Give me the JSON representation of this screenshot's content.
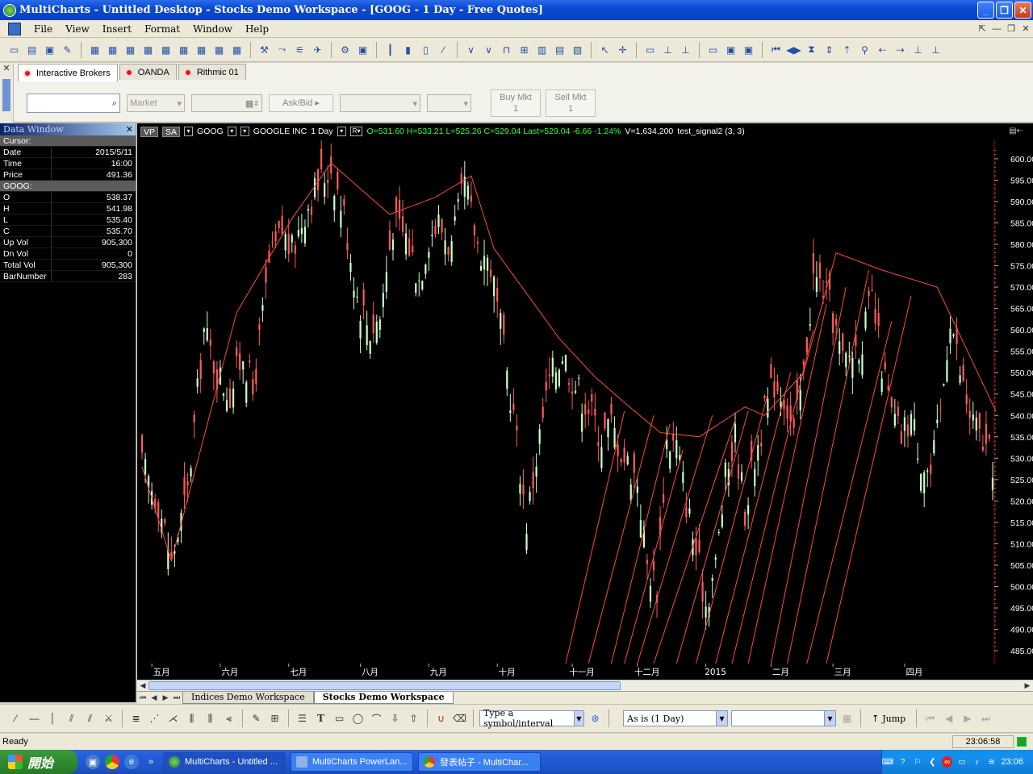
{
  "window": {
    "title": "MultiCharts - Untitled Desktop - Stocks Demo Workspace - [GOOG - 1 Day - Free Quotes]"
  },
  "menu": [
    "File",
    "View",
    "Insert",
    "Format",
    "Window",
    "Help"
  ],
  "trading_panel": {
    "tabs": [
      "Interactive Brokers",
      "OANDA",
      "Rithmic 01"
    ],
    "order_type": "Market",
    "price_mode": "Ask/Bid",
    "buy_label": "Buy Mkt",
    "buy_qty": "1",
    "sell_label": "Sell Mkt",
    "sell_qty": "1"
  },
  "data_window": {
    "title": "Data Window",
    "cursor_header": "Cursor:",
    "date_label": "Date",
    "date_value": "2015/5/11",
    "time_label": "Time",
    "time_value": "16:00",
    "price_label": "Price",
    "price_value": "491.36",
    "symbol_header": "GOOG:",
    "o_label": "O",
    "o_value": "538.37",
    "h_label": "H",
    "h_value": "541.98",
    "l_label": "L",
    "l_value": "535.40",
    "c_label": "C",
    "c_value": "535.70",
    "upvol_label": "Up Vol",
    "upvol_value": "905,300",
    "dnvol_label": "Dn Vol",
    "dnvol_value": "0",
    "totvol_label": "Total Vol",
    "totvol_value": "905,300",
    "barnum_label": "BarNumber",
    "barnum_value": "283"
  },
  "chart_header": {
    "vp": "VP",
    "sa": "SA",
    "symbol": "GOOG",
    "description": "GOOGLE INC",
    "interval": "1 Day",
    "r": "R",
    "ohlc": "O=531.60  H=533.21  L=525.26  C=529.04  Last=529.04  -6.66  -1.24%",
    "volume": "V=1,634,200",
    "study": "test_signal2 (3, 3)"
  },
  "chart_data": {
    "type": "candlestick",
    "ylim": [
      482,
      603
    ],
    "y_ticks": [
      485,
      490,
      495,
      500,
      505,
      510,
      515,
      520,
      525,
      530,
      535,
      540,
      545,
      550,
      555,
      560,
      565,
      570,
      575,
      580,
      585,
      590,
      595,
      600
    ],
    "y_tick_labels": [
      "485.00",
      "490.00",
      "495.00",
      "500.00",
      "505.00",
      "510.00",
      "515.00",
      "520.00",
      "525.00",
      "530.00",
      "535.00",
      "540.00",
      "545.00",
      "550.00",
      "555.00",
      "560.00",
      "565.00",
      "570.00",
      "575.00",
      "580.00",
      "585.00",
      "590.00",
      "595.00",
      "600.00"
    ],
    "x_labels": [
      {
        "label": "五月",
        "bar": 3
      },
      {
        "label": "六月",
        "bar": 24
      },
      {
        "label": "七月",
        "bar": 45
      },
      {
        "label": "八月",
        "bar": 67
      },
      {
        "label": "九月",
        "bar": 88
      },
      {
        "label": "十月",
        "bar": 109
      },
      {
        "label": "十一月",
        "bar": 132
      },
      {
        "label": "十二月",
        "bar": 152
      },
      {
        "label": "2015",
        "bar": 173
      },
      {
        "label": "二月",
        "bar": 193
      },
      {
        "label": "三月",
        "bar": 212
      },
      {
        "label": "四月",
        "bar": 234
      }
    ],
    "bar_count": 262,
    "close_path": [
      [
        0,
        528
      ],
      [
        5,
        520
      ],
      [
        9,
        506
      ],
      [
        14,
        522
      ],
      [
        19,
        560
      ],
      [
        23,
        550
      ],
      [
        27,
        545
      ],
      [
        31,
        555
      ],
      [
        34,
        545
      ],
      [
        39,
        575
      ],
      [
        43,
        583
      ],
      [
        46,
        578
      ],
      [
        50,
        588
      ],
      [
        54,
        594
      ],
      [
        58,
        598
      ],
      [
        62,
        587
      ],
      [
        66,
        568
      ],
      [
        70,
        560
      ],
      [
        73,
        563
      ],
      [
        77,
        585
      ],
      [
        81,
        582
      ],
      [
        85,
        572
      ],
      [
        88,
        582
      ],
      [
        91,
        585
      ],
      [
        95,
        579
      ],
      [
        99,
        594
      ],
      [
        103,
        580
      ],
      [
        107,
        575
      ],
      [
        110,
        560
      ],
      [
        114,
        540
      ],
      [
        118,
        515
      ],
      [
        122,
        535
      ],
      [
        125,
        548
      ],
      [
        129,
        555
      ],
      [
        133,
        547
      ],
      [
        137,
        542
      ],
      [
        141,
        535
      ],
      [
        144,
        538
      ],
      [
        148,
        530
      ],
      [
        152,
        525
      ],
      [
        155,
        505
      ],
      [
        158,
        500
      ],
      [
        161,
        534
      ],
      [
        164,
        533
      ],
      [
        167,
        520
      ],
      [
        170,
        508
      ],
      [
        173,
        496
      ],
      [
        176,
        505
      ],
      [
        179,
        525
      ],
      [
        182,
        535
      ],
      [
        185,
        518
      ],
      [
        188,
        530
      ],
      [
        191,
        540
      ],
      [
        194,
        548
      ],
      [
        197,
        545
      ],
      [
        200,
        535
      ],
      [
        203,
        550
      ],
      [
        206,
        572
      ],
      [
        209,
        570
      ],
      [
        212,
        563
      ],
      [
        215,
        552
      ],
      [
        218,
        555
      ],
      [
        221,
        558
      ],
      [
        224,
        567
      ],
      [
        227,
        552
      ],
      [
        230,
        540
      ],
      [
        233,
        535
      ],
      [
        236,
        540
      ],
      [
        239,
        530
      ],
      [
        242,
        526
      ],
      [
        245,
        540
      ],
      [
        248,
        564
      ],
      [
        251,
        550
      ],
      [
        254,
        540
      ],
      [
        257,
        535
      ],
      [
        261,
        529
      ]
    ],
    "swing_line": [
      [
        0,
        528
      ],
      [
        9,
        506
      ],
      [
        29,
        564
      ],
      [
        46,
        586
      ],
      [
        58,
        599
      ],
      [
        76,
        587
      ],
      [
        90,
        591
      ],
      [
        101,
        596
      ],
      [
        108,
        579
      ],
      [
        128,
        558
      ],
      [
        139,
        549
      ],
      [
        148,
        543
      ],
      [
        159,
        536
      ],
      [
        171,
        535
      ],
      [
        185,
        542
      ],
      [
        191,
        540
      ],
      [
        203,
        550
      ],
      [
        213,
        578
      ],
      [
        227,
        574
      ],
      [
        244,
        570
      ],
      [
        262,
        541
      ]
    ],
    "trend_lines": [
      [
        [
          130,
          482
        ],
        [
          148,
          541
        ]
      ],
      [
        [
          137,
          482
        ],
        [
          157,
          540
        ]
      ],
      [
        [
          144,
          482
        ],
        [
          162,
          538
        ]
      ],
      [
        [
          148,
          482
        ],
        [
          166,
          532
        ]
      ],
      [
        [
          152,
          482
        ],
        [
          175,
          540
        ]
      ],
      [
        [
          157,
          482
        ],
        [
          182,
          539
        ]
      ],
      [
        [
          164,
          482
        ],
        [
          186,
          541
        ]
      ],
      [
        [
          170,
          482
        ],
        [
          192,
          545
        ]
      ],
      [
        [
          176,
          482
        ],
        [
          199,
          550
        ]
      ],
      [
        [
          181,
          482
        ],
        [
          206,
          560
        ]
      ],
      [
        [
          186,
          482
        ],
        [
          210,
          566
        ]
      ],
      [
        [
          193,
          482
        ],
        [
          216,
          570
        ]
      ],
      [
        [
          198,
          482
        ],
        [
          223,
          574
        ]
      ],
      [
        [
          204,
          482
        ],
        [
          230,
          562
        ]
      ],
      [
        [
          210,
          482
        ],
        [
          236,
          568
        ]
      ]
    ]
  },
  "scrollbar": {},
  "workspace_tabs": [
    "Indices Demo Workspace",
    "Stocks Demo Workspace"
  ],
  "drawing_toolbar": {
    "symbol_placeholder": "Type a symbol/interval",
    "resolution": "As is (1 Day)",
    "jump": "Jump"
  },
  "status": {
    "text": "Ready",
    "clock": "23:06:58"
  },
  "taskbar": {
    "start": "開始",
    "tasks": [
      "MultiCharts - Untitled ...",
      "MultiCharts PowerLan...",
      "發表帖子 - MultiChar..."
    ],
    "time": "23:06"
  },
  "colors": {
    "up_candle": "#c8ffc8",
    "down_candle": "#ff5a5a",
    "indicator": "#ff4a3a",
    "price_axis": "#ffffff"
  }
}
